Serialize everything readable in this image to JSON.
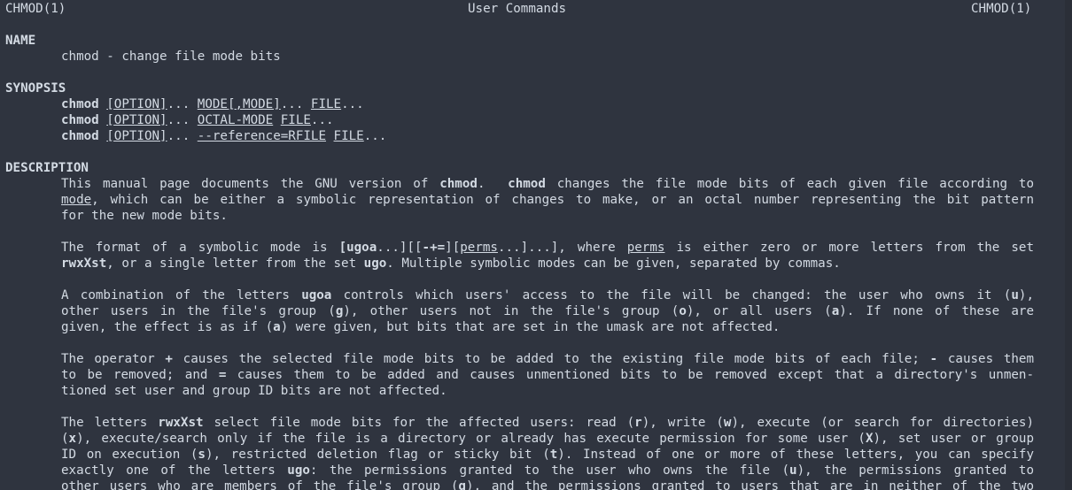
{
  "header": {
    "left": "CHMOD(1)",
    "center": "User Commands",
    "right": "CHMOD(1)"
  },
  "name": {
    "heading": "NAME",
    "text": "chmod - change file mode bits"
  },
  "synopsis": {
    "heading": "SYNOPSIS",
    "cmd": "chmod",
    "option": "[OPTION]",
    "dots": "...",
    "l1_mode": "MODE[,MODE]",
    "l1_file": "FILE",
    "l2_octal": "OCTAL-MODE",
    "l2_file": "FILE",
    "l3_ref": "--reference=RFILE",
    "l3_file": "FILE"
  },
  "description": {
    "heading": "DESCRIPTION"
  },
  "p1": {
    "a": "This manual page documents the GNU version of ",
    "b": "chmod",
    "c": ". ",
    "d": "chmod",
    "e": " changes the file mode bits of each given file according to",
    "f": "mode",
    "g": ", which can be either a symbolic representation of changes to make, or an octal number representing the bit pattern",
    "h": "for the new mode bits."
  },
  "p2": {
    "a": "The format of a symbolic mode is ",
    "b": "[ugoa",
    "c": "...][[",
    "d": "-+=",
    "e": "][",
    "f": "perms",
    "g": "...]...], where ",
    "h": "perms",
    "i": " is either zero or more letters from the set",
    "j": "rwxXst",
    "k": ", or a single letter from the set ",
    "l": "ugo",
    "m": ". Multiple symbolic modes can be given, separated by commas."
  },
  "p3": {
    "a": "A combination of the letters ",
    "b": "ugoa",
    "c": " controls which users' access to the file will be changed: the user who owns it (",
    "d": "u",
    "e": "),",
    "f": "other users in the file's group (",
    "g": "g",
    "h": "), other users not in the file's group (",
    "i": "o",
    "j": "), or all users (",
    "k": "a",
    "l": "). If none of these are",
    "m": "given, the effect is as if (",
    "n": "a",
    "o": ") were given, but bits that are set in the umask are not affected."
  },
  "p4": {
    "a": "The operator ",
    "b": "+",
    "c": " causes the selected file mode bits to be added to the existing file mode bits of each file; ",
    "d": "-",
    "e": " causes them",
    "f": "to be removed; and ",
    "g": "=",
    "h": " causes them to be added and causes unmentioned bits to be removed except that a directory's unmen-",
    "i": "tioned set user and group ID bits are not affected."
  },
  "p5": {
    "a": "The letters ",
    "b": "rwxXst",
    "c": " select file mode bits for the affected users: read (",
    "d": "r",
    "e": "), write (",
    "f": "w",
    "g": "), execute (or search for directories)",
    "h": "(",
    "i": "x",
    "j": "), execute/search only if the file is a directory or already has execute permission for some user (",
    "k": "X",
    "l": "), set user or group",
    "m": "ID on execution (",
    "n": "s",
    "o": "), restricted deletion flag or sticky bit (",
    "p": "t",
    "q": "). Instead of one or more of these letters, you can specify",
    "r": "exactly one of the letters ",
    "s": "ugo",
    "t": ": the permissions granted to the user who owns the file (",
    "u": "u",
    "v": "), the permissions granted to",
    "w": "other users who are members of the file's group (",
    "x": "g",
    "y": "), and the permissions granted to users that are in neither of the two"
  }
}
